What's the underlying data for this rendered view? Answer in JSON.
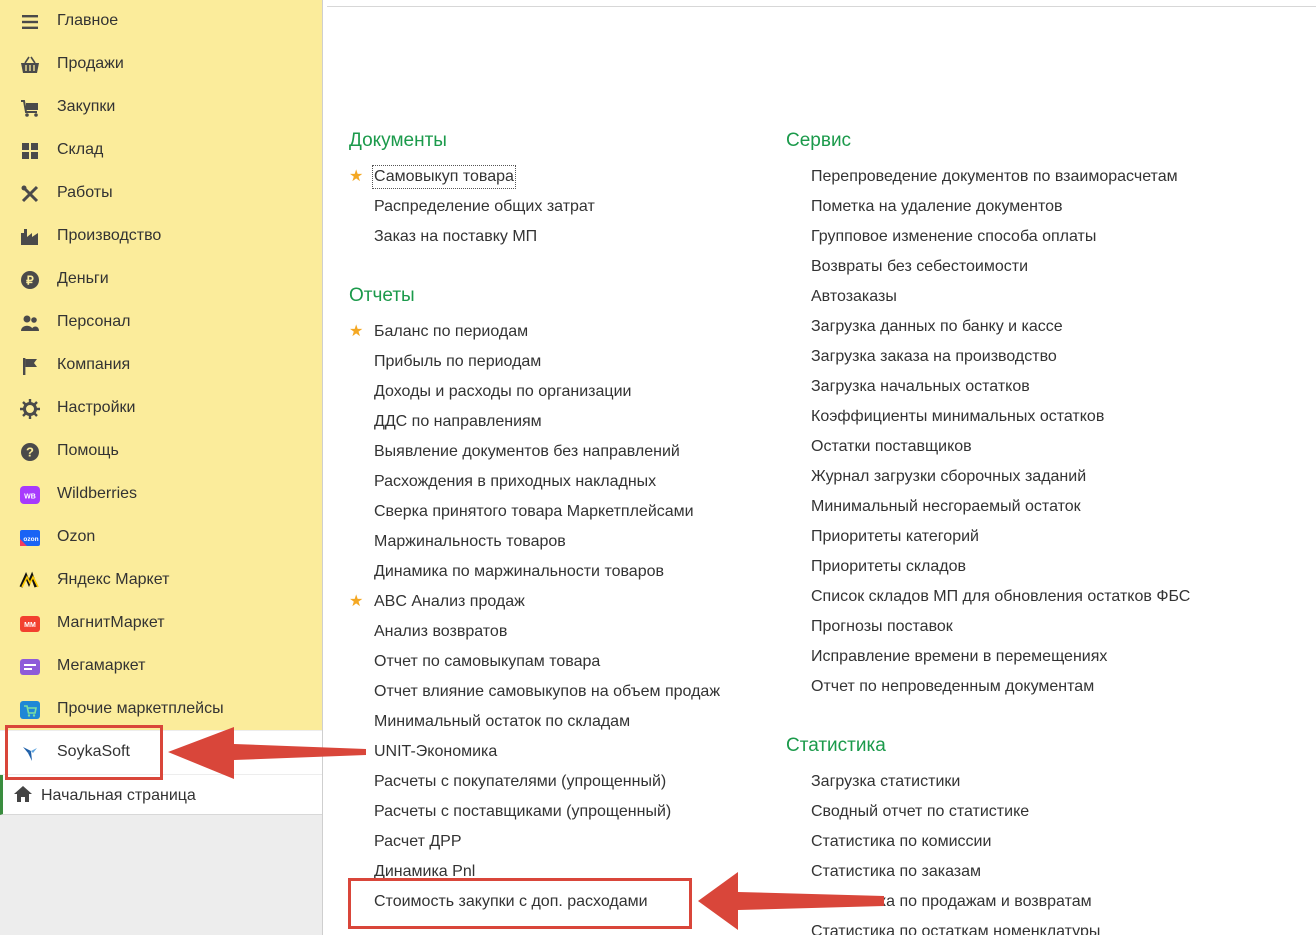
{
  "sidebar": {
    "sections": [
      {
        "label": "Главное",
        "icon": "menu-lines-icon"
      },
      {
        "label": "Продажи",
        "icon": "basket-icon"
      },
      {
        "label": "Закупки",
        "icon": "cart-icon"
      },
      {
        "label": "Склад",
        "icon": "warehouse-grid-icon"
      },
      {
        "label": "Работы",
        "icon": "tools-icon"
      },
      {
        "label": "Производство",
        "icon": "factory-icon"
      },
      {
        "label": "Деньги",
        "icon": "ruble-icon"
      },
      {
        "label": "Персонал",
        "icon": "people-icon"
      },
      {
        "label": "Компания",
        "icon": "flag-icon"
      },
      {
        "label": "Настройки",
        "icon": "gear-icon"
      },
      {
        "label": "Помощь",
        "icon": "help-icon"
      },
      {
        "label": "Wildberries",
        "icon": "wildberries-icon",
        "badge": "WB"
      },
      {
        "label": "Ozon",
        "icon": "ozon-icon",
        "badge": "ozon"
      },
      {
        "label": "Яндекс Маркет",
        "icon": "yandex-market-icon"
      },
      {
        "label": "МагнитМаркет",
        "icon": "magnit-market-icon"
      },
      {
        "label": "Мегамаркет",
        "icon": "megamarket-icon"
      },
      {
        "label": "Прочие маркетплейсы",
        "icon": "marketplace-cart-icon"
      }
    ],
    "soyka": {
      "label": "SoykaSoft",
      "icon": "soykasoft-logo-icon"
    },
    "home": {
      "label": "Начальная страница",
      "icon": "home-icon"
    }
  },
  "colors": {
    "sidebar_bg": "#fbec9b",
    "group_title": "#1b9a4b",
    "annotation": "#d9463a",
    "star": "#f4a823"
  },
  "main": {
    "documents": {
      "title": "Документы",
      "items": [
        {
          "label": "Самовыкуп товара",
          "starred": true
        },
        {
          "label": "Распределение общих затрат"
        },
        {
          "label": "Заказ на поставку МП"
        }
      ]
    },
    "reports": {
      "title": "Отчеты",
      "items": [
        {
          "label": "Баланс по периодам",
          "starred": true
        },
        {
          "label": "Прибыль по периодам"
        },
        {
          "label": "Доходы и расходы по организации"
        },
        {
          "label": "ДДС по направлениям"
        },
        {
          "label": "Выявление документов без направлений"
        },
        {
          "label": "Расхождения в приходных накладных"
        },
        {
          "label": "Сверка принятого товара Маркетплейсами"
        },
        {
          "label": "Маржинальность товаров"
        },
        {
          "label": "Динамика по маржинальности товаров"
        },
        {
          "label": "ABC Анализ продаж",
          "starred": true
        },
        {
          "label": "Анализ возвратов"
        },
        {
          "label": "Отчет по самовыкупам товара"
        },
        {
          "label": "Отчет влияние самовыкупов на объем продаж"
        },
        {
          "label": "Минимальный остаток по складам"
        },
        {
          "label": "UNIT-Экономика"
        },
        {
          "label": "Расчеты с покупателями (упрощенный)"
        },
        {
          "label": "Расчеты с поставщиками (упрощенный)"
        },
        {
          "label": "Расчет ДРР"
        },
        {
          "label": "Динамика Pnl"
        },
        {
          "label": "Стоимость закупки с доп. расходами"
        }
      ]
    },
    "service": {
      "title": "Сервис",
      "items": [
        {
          "label": "Перепроведение документов по взаиморасчетам"
        },
        {
          "label": "Пометка на удаление документов"
        },
        {
          "label": "Групповое изменение способа оплаты"
        },
        {
          "label": "Возвраты без себестоимости"
        },
        {
          "label": "Автозаказы"
        },
        {
          "label": "Загрузка данных по банку и кассе"
        },
        {
          "label": "Загрузка заказа на производство"
        },
        {
          "label": "Загрузка начальных остатков"
        },
        {
          "label": "Коэффициенты минимальных остатков"
        },
        {
          "label": "Остатки поставщиков"
        },
        {
          "label": "Журнал загрузки сборочных заданий"
        },
        {
          "label": "Минимальный несгораемый остаток"
        },
        {
          "label": "Приоритеты категорий"
        },
        {
          "label": "Приоритеты складов"
        },
        {
          "label": "Список складов МП для обновления остатков ФБС"
        },
        {
          "label": "Прогнозы поставок"
        },
        {
          "label": "Исправление времени в перемещениях"
        },
        {
          "label": "Отчет по непроведенным документам"
        }
      ]
    },
    "statistics": {
      "title": "Статистика",
      "items": [
        {
          "label": "Загрузка статистики"
        },
        {
          "label": "Сводный отчет по статистике"
        },
        {
          "label": "Статистика по комиссии"
        },
        {
          "label": "Статистика по заказам"
        },
        {
          "label": "Статистика по продажам и возвратам"
        },
        {
          "label": "Статистика по остаткам номенклатуры"
        }
      ]
    }
  }
}
